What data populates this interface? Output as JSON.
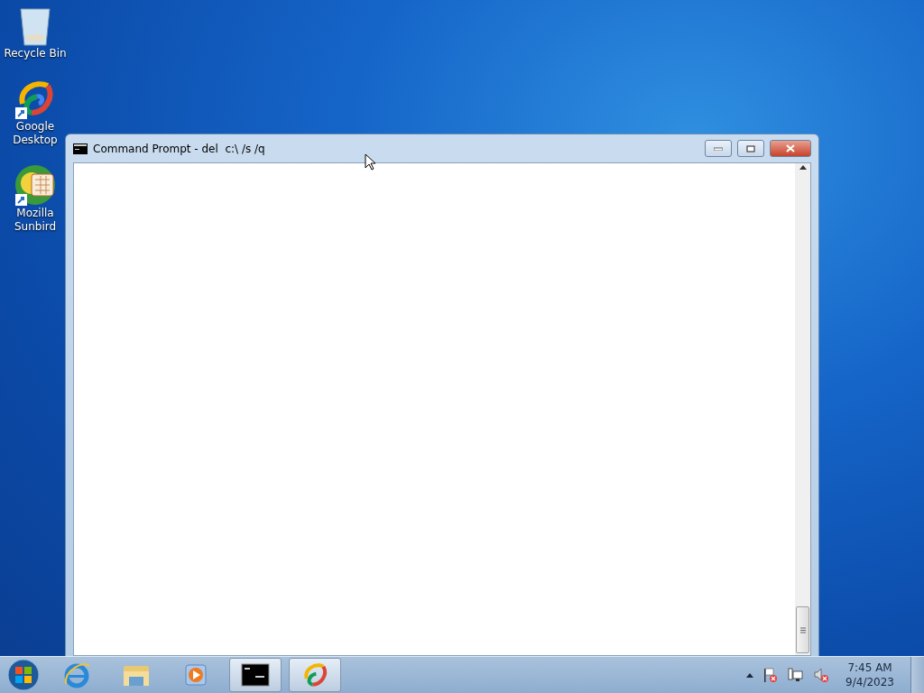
{
  "desktop_icons": [
    {
      "label": "Recycle Bin",
      "kind": "recycle"
    },
    {
      "label": "Google Desktop",
      "kind": "google"
    },
    {
      "label": "Mozilla Sunbird",
      "kind": "sunbird"
    }
  ],
  "window": {
    "title": "Command Prompt - del  c:\\ /s /q"
  },
  "taskbar": {
    "apps": [
      {
        "kind": "ie",
        "open": false
      },
      {
        "kind": "explorer",
        "open": false
      },
      {
        "kind": "media",
        "open": false
      },
      {
        "kind": "cmd",
        "open": true
      },
      {
        "kind": "google",
        "open": true
      }
    ],
    "clock": {
      "time": "7:45 AM",
      "date": "9/4/2023"
    }
  }
}
